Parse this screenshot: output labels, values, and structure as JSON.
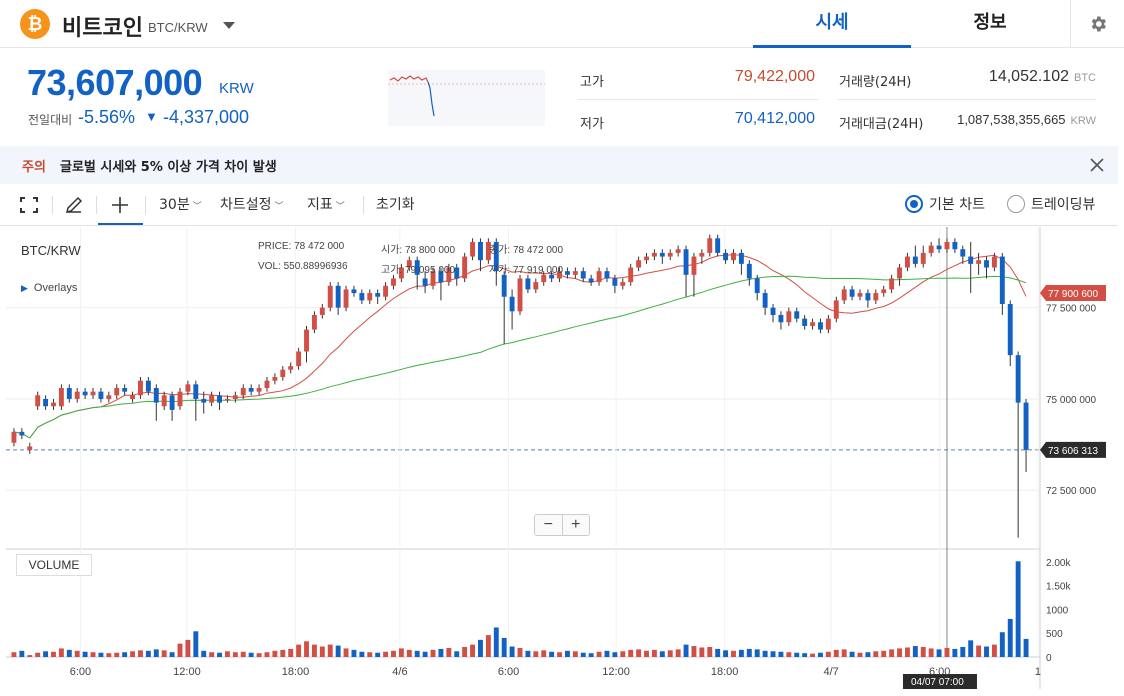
{
  "header": {
    "coin_logo": "₿",
    "coin_name": "비트코인",
    "pair": "BTC/KRW",
    "tabs": [
      {
        "label": "시세",
        "active": true
      },
      {
        "label": "정보",
        "active": false
      }
    ],
    "icons": {
      "logo": "bitcoin-icon",
      "dropdown": "caret-down-icon",
      "settings": "gear-icon"
    }
  },
  "price": {
    "current": "73,607,000",
    "unit": "KRW",
    "change_label": "전일대비",
    "change_rate": "-5.56%",
    "change_arrow": "▼",
    "change_amount": "-4,337,000"
  },
  "stats": {
    "high_label": "고가",
    "high_value": "79,422,000",
    "low_label": "저가",
    "low_value": "70,412,000",
    "volume_label": "거래량(24H)",
    "volume_value": "14,052.102",
    "volume_unit": "BTC",
    "amount_label": "거래대금(24H)",
    "amount_value": "1,087,538,355,665",
    "amount_unit": "KRW"
  },
  "notice": {
    "tag": "주의",
    "text": "글로벌 시세와 5% 이상 가격 차이 발생"
  },
  "toolbar": {
    "interval": "30분",
    "chart_settings": "차트설정",
    "indicators": "지표",
    "reset": "초기화",
    "chart_type_basic": "기본 차트",
    "chart_type_tradingview": "트레이딩뷰",
    "selected_chart_type": "기본 차트"
  },
  "chart_legend": {
    "pair": "BTC/KRW",
    "overlays": "Overlays",
    "price_label": "PRICE:",
    "price_value": "78 472 000",
    "vol_label": "VOL:",
    "vol_value": "550.88996936",
    "open_label": "시가:",
    "open_value": "78 800 000",
    "high_label": "고가:",
    "high_value": "79 095 000",
    "close_label": "종가:",
    "close_value": "78 472 000",
    "low_label": "저가:",
    "low_value": "77 919 000",
    "volume_panel": "VOLUME"
  },
  "colors": {
    "up": "#d24f45",
    "down": "#1261c4",
    "ma_short": "#d24f45",
    "ma_long": "#3cb043"
  },
  "chart_data": {
    "type": "candlestick",
    "price_axis_ticks": [
      "77 500 000",
      "75 000 000",
      "72 500 000"
    ],
    "price_tick_values": [
      77500000,
      75000000,
      72500000
    ],
    "price_badges": [
      {
        "label": "77 900 600",
        "value": 77900600,
        "kind": "ma"
      },
      {
        "label": "73 606 313",
        "value": 73606313,
        "kind": "last"
      }
    ],
    "volume_axis_ticks": [
      "2.00k",
      "1.50k",
      "1000",
      "500",
      "0"
    ],
    "time_labels": [
      "6:00",
      "12:00",
      "18:00",
      "4/6",
      "6:00",
      "12:00",
      "18:00",
      "4/7",
      "6:00",
      "1"
    ],
    "crosshair_label": "04/07 07:00",
    "candles": [
      {
        "o": 73800000,
        "c": 74100000,
        "h": 74200000,
        "l": 73700000,
        "v": 100
      },
      {
        "o": 74100000,
        "c": 74000000,
        "h": 74200000,
        "l": 73900000,
        "v": 130
      },
      {
        "o": 73600000,
        "c": 73700000,
        "h": 73800000,
        "l": 73500000,
        "v": 40
      },
      {
        "o": 74800000,
        "c": 75100000,
        "h": 75200000,
        "l": 74700000,
        "v": 90
      },
      {
        "o": 75000000,
        "c": 74800000,
        "h": 75100000,
        "l": 74700000,
        "v": 120
      },
      {
        "o": 74800000,
        "c": 74900000,
        "h": 75000000,
        "l": 74700000,
        "v": 110
      },
      {
        "o": 74800000,
        "c": 75300000,
        "h": 75400000,
        "l": 74700000,
        "v": 180
      },
      {
        "o": 75300000,
        "c": 75000000,
        "h": 75400000,
        "l": 74900000,
        "v": 150
      },
      {
        "o": 75000000,
        "c": 75200000,
        "h": 75300000,
        "l": 74900000,
        "v": 130
      },
      {
        "o": 75200000,
        "c": 75100000,
        "h": 75300000,
        "l": 75000000,
        "v": 110
      },
      {
        "o": 75100000,
        "c": 75200000,
        "h": 75300000,
        "l": 75000000,
        "v": 100
      },
      {
        "o": 75200000,
        "c": 75000000,
        "h": 75300000,
        "l": 74900000,
        "v": 90
      },
      {
        "o": 75000000,
        "c": 75100000,
        "h": 75200000,
        "l": 74900000,
        "v": 80
      },
      {
        "o": 75100000,
        "c": 75300000,
        "h": 75400000,
        "l": 75000000,
        "v": 90
      },
      {
        "o": 75300000,
        "c": 75200000,
        "h": 75400000,
        "l": 75100000,
        "v": 100
      },
      {
        "o": 75000000,
        "c": 75100000,
        "h": 75200000,
        "l": 74900000,
        "v": 120
      },
      {
        "o": 75100000,
        "c": 75500000,
        "h": 75600000,
        "l": 75000000,
        "v": 140
      },
      {
        "o": 75500000,
        "c": 75200000,
        "h": 75600000,
        "l": 75100000,
        "v": 130
      },
      {
        "o": 75300000,
        "c": 74900000,
        "h": 75400000,
        "l": 74400000,
        "v": 160
      },
      {
        "o": 74800000,
        "c": 75100000,
        "h": 75200000,
        "l": 74700000,
        "v": 140
      },
      {
        "o": 75100000,
        "c": 74700000,
        "h": 75200000,
        "l": 74400000,
        "v": 100
      },
      {
        "o": 74800000,
        "c": 75200000,
        "h": 75300000,
        "l": 74700000,
        "v": 280
      },
      {
        "o": 75200000,
        "c": 75400000,
        "h": 75500000,
        "l": 75100000,
        "v": 360
      },
      {
        "o": 75400000,
        "c": 75000000,
        "h": 75500000,
        "l": 74400000,
        "v": 540
      },
      {
        "o": 75000000,
        "c": 74900000,
        "h": 75200000,
        "l": 74600000,
        "v": 130
      },
      {
        "o": 74900000,
        "c": 75100000,
        "h": 75200000,
        "l": 74800000,
        "v": 100
      },
      {
        "o": 75100000,
        "c": 74900000,
        "h": 75200000,
        "l": 74700000,
        "v": 90
      },
      {
        "o": 75000000,
        "c": 75000000,
        "h": 75100000,
        "l": 74900000,
        "v": 120
      },
      {
        "o": 75000000,
        "c": 75100000,
        "h": 75200000,
        "l": 74900000,
        "v": 100
      },
      {
        "o": 75100000,
        "c": 75300000,
        "h": 75400000,
        "l": 75000000,
        "v": 110
      },
      {
        "o": 75300000,
        "c": 75200000,
        "h": 75400000,
        "l": 75100000,
        "v": 90
      },
      {
        "o": 75200000,
        "c": 75300000,
        "h": 75400000,
        "l": 75100000,
        "v": 80
      },
      {
        "o": 75300000,
        "c": 75500000,
        "h": 75600000,
        "l": 75200000,
        "v": 100
      },
      {
        "o": 75500000,
        "c": 75600000,
        "h": 75700000,
        "l": 75400000,
        "v": 130
      },
      {
        "o": 75600000,
        "c": 75800000,
        "h": 75900000,
        "l": 75500000,
        "v": 150
      },
      {
        "o": 75800000,
        "c": 75900000,
        "h": 76000000,
        "l": 75700000,
        "v": 170
      },
      {
        "o": 75900000,
        "c": 76300000,
        "h": 76400000,
        "l": 75800000,
        "v": 260
      },
      {
        "o": 76300000,
        "c": 76900000,
        "h": 77000000,
        "l": 76000000,
        "v": 330
      },
      {
        "o": 76900000,
        "c": 77300000,
        "h": 77400000,
        "l": 76800000,
        "v": 260
      },
      {
        "o": 77300000,
        "c": 77500000,
        "h": 77600000,
        "l": 77200000,
        "v": 220
      },
      {
        "o": 77500000,
        "c": 78100000,
        "h": 78200000,
        "l": 77400000,
        "v": 260
      },
      {
        "o": 78100000,
        "c": 77500000,
        "h": 78200000,
        "l": 77300000,
        "v": 240
      },
      {
        "o": 77500000,
        "c": 78000000,
        "h": 78100000,
        "l": 77400000,
        "v": 180
      },
      {
        "o": 78000000,
        "c": 77900000,
        "h": 78100000,
        "l": 77800000,
        "v": 150
      },
      {
        "o": 77900000,
        "c": 77700000,
        "h": 78000000,
        "l": 77600000,
        "v": 110
      },
      {
        "o": 77700000,
        "c": 77900000,
        "h": 78000000,
        "l": 77600000,
        "v": 100
      },
      {
        "o": 77900000,
        "c": 77800000,
        "h": 78000000,
        "l": 77600000,
        "v": 90
      },
      {
        "o": 77800000,
        "c": 78100000,
        "h": 78200000,
        "l": 77700000,
        "v": 110
      },
      {
        "o": 78100000,
        "c": 78300000,
        "h": 78400000,
        "l": 78000000,
        "v": 130
      },
      {
        "o": 78300000,
        "c": 78600000,
        "h": 78700000,
        "l": 78200000,
        "v": 180
      },
      {
        "o": 78600000,
        "c": 78800000,
        "h": 78900000,
        "l": 78500000,
        "v": 150
      },
      {
        "o": 78800000,
        "c": 78400000,
        "h": 78900000,
        "l": 78000000,
        "v": 130
      },
      {
        "o": 78300000,
        "c": 78100000,
        "h": 78500000,
        "l": 77900000,
        "v": 110
      },
      {
        "o": 78100000,
        "c": 78500000,
        "h": 78600000,
        "l": 78000000,
        "v": 150
      },
      {
        "o": 78500000,
        "c": 78200000,
        "h": 78600000,
        "l": 77700000,
        "v": 170
      },
      {
        "o": 78200000,
        "c": 78600000,
        "h": 78700000,
        "l": 78100000,
        "v": 190
      },
      {
        "o": 78600000,
        "c": 78300000,
        "h": 78700000,
        "l": 78100000,
        "v": 120
      },
      {
        "o": 78300000,
        "c": 78900000,
        "h": 79000000,
        "l": 78200000,
        "v": 210
      },
      {
        "o": 78900000,
        "c": 79300000,
        "h": 79400000,
        "l": 78800000,
        "v": 260
      },
      {
        "o": 79300000,
        "c": 78800000,
        "h": 79400000,
        "l": 78500000,
        "v": 360
      },
      {
        "o": 78800000,
        "c": 79300000,
        "h": 79400000,
        "l": 78700000,
        "v": 460
      },
      {
        "o": 79300000,
        "c": 78500000,
        "h": 79400000,
        "l": 78100000,
        "v": 620
      },
      {
        "o": 78400000,
        "c": 77800000,
        "h": 78500000,
        "l": 76500000,
        "v": 400
      },
      {
        "o": 77800000,
        "c": 77400000,
        "h": 78000000,
        "l": 76900000,
        "v": 220
      },
      {
        "o": 77400000,
        "c": 78300000,
        "h": 78400000,
        "l": 77300000,
        "v": 190
      },
      {
        "o": 78300000,
        "c": 78000000,
        "h": 78400000,
        "l": 77900000,
        "v": 130
      },
      {
        "o": 78000000,
        "c": 78200000,
        "h": 78300000,
        "l": 77900000,
        "v": 120
      },
      {
        "o": 78200000,
        "c": 78400000,
        "h": 78500000,
        "l": 78100000,
        "v": 140
      },
      {
        "o": 78400000,
        "c": 78300000,
        "h": 78500000,
        "l": 78200000,
        "v": 110
      },
      {
        "o": 78300000,
        "c": 78500000,
        "h": 78600000,
        "l": 78200000,
        "v": 100
      },
      {
        "o": 78500000,
        "c": 78400000,
        "h": 78600000,
        "l": 78300000,
        "v": 130
      },
      {
        "o": 78400000,
        "c": 78500000,
        "h": 78600000,
        "l": 78300000,
        "v": 120
      },
      {
        "o": 78500000,
        "c": 78300000,
        "h": 78600000,
        "l": 78200000,
        "v": 90
      },
      {
        "o": 78300000,
        "c": 78200000,
        "h": 78400000,
        "l": 78100000,
        "v": 80
      },
      {
        "o": 78200000,
        "c": 78500000,
        "h": 78600000,
        "l": 78100000,
        "v": 110
      },
      {
        "o": 78500000,
        "c": 78300000,
        "h": 78600000,
        "l": 78200000,
        "v": 130
      },
      {
        "o": 78300000,
        "c": 78100000,
        "h": 78400000,
        "l": 77900000,
        "v": 100
      },
      {
        "o": 78100000,
        "c": 78200000,
        "h": 78300000,
        "l": 78000000,
        "v": 120
      },
      {
        "o": 78200000,
        "c": 78600000,
        "h": 78700000,
        "l": 78100000,
        "v": 150
      },
      {
        "o": 78600000,
        "c": 78800000,
        "h": 78900000,
        "l": 78500000,
        "v": 160
      },
      {
        "o": 78800000,
        "c": 78900000,
        "h": 79000000,
        "l": 78700000,
        "v": 130
      },
      {
        "o": 78900000,
        "c": 79000000,
        "h": 79100000,
        "l": 78800000,
        "v": 150
      },
      {
        "o": 79000000,
        "c": 78900000,
        "h": 79100000,
        "l": 78700000,
        "v": 120
      },
      {
        "o": 78900000,
        "c": 79000000,
        "h": 79100000,
        "l": 78800000,
        "v": 140
      },
      {
        "o": 79000000,
        "c": 79100000,
        "h": 79200000,
        "l": 78900000,
        "v": 160
      },
      {
        "o": 79100000,
        "c": 78400000,
        "h": 79200000,
        "l": 77800000,
        "v": 260
      },
      {
        "o": 78400000,
        "c": 78900000,
        "h": 79000000,
        "l": 77800000,
        "v": 230
      },
      {
        "o": 78900000,
        "c": 79000000,
        "h": 79100000,
        "l": 78700000,
        "v": 200
      },
      {
        "o": 79000000,
        "c": 79400000,
        "h": 79500000,
        "l": 78900000,
        "v": 210
      },
      {
        "o": 79400000,
        "c": 79000000,
        "h": 79500000,
        "l": 78900000,
        "v": 170
      },
      {
        "o": 79000000,
        "c": 78800000,
        "h": 79100000,
        "l": 78700000,
        "v": 140
      },
      {
        "o": 78800000,
        "c": 79000000,
        "h": 79100000,
        "l": 78700000,
        "v": 130
      },
      {
        "o": 79000000,
        "c": 78700000,
        "h": 79100000,
        "l": 78400000,
        "v": 150
      },
      {
        "o": 78700000,
        "c": 78300000,
        "h": 78800000,
        "l": 78100000,
        "v": 170
      },
      {
        "o": 78300000,
        "c": 77900000,
        "h": 78400000,
        "l": 77700000,
        "v": 160
      },
      {
        "o": 77900000,
        "c": 77500000,
        "h": 78000000,
        "l": 77300000,
        "v": 130
      },
      {
        "o": 77500000,
        "c": 77300000,
        "h": 77600000,
        "l": 77100000,
        "v": 120
      },
      {
        "o": 77300000,
        "c": 77100000,
        "h": 77400000,
        "l": 76900000,
        "v": 110
      },
      {
        "o": 77100000,
        "c": 77400000,
        "h": 77500000,
        "l": 77000000,
        "v": 100
      },
      {
        "o": 77400000,
        "c": 77200000,
        "h": 77500000,
        "l": 77100000,
        "v": 90
      },
      {
        "o": 77200000,
        "c": 77000000,
        "h": 77300000,
        "l": 76900000,
        "v": 80
      },
      {
        "o": 77000000,
        "c": 77100000,
        "h": 77200000,
        "l": 76900000,
        "v": 70
      },
      {
        "o": 77100000,
        "c": 76900000,
        "h": 77200000,
        "l": 76800000,
        "v": 90
      },
      {
        "o": 76900000,
        "c": 77200000,
        "h": 77300000,
        "l": 76800000,
        "v": 110
      },
      {
        "o": 77200000,
        "c": 77700000,
        "h": 77800000,
        "l": 77100000,
        "v": 150
      },
      {
        "o": 77700000,
        "c": 78000000,
        "h": 78100000,
        "l": 77600000,
        "v": 160
      },
      {
        "o": 78000000,
        "c": 77800000,
        "h": 78100000,
        "l": 77700000,
        "v": 110
      },
      {
        "o": 77800000,
        "c": 77900000,
        "h": 78000000,
        "l": 77700000,
        "v": 90
      },
      {
        "o": 77900000,
        "c": 77700000,
        "h": 78000000,
        "l": 77500000,
        "v": 100
      },
      {
        "o": 77700000,
        "c": 77900000,
        "h": 78000000,
        "l": 77600000,
        "v": 120
      },
      {
        "o": 77900000,
        "c": 78000000,
        "h": 78100000,
        "l": 77800000,
        "v": 130
      },
      {
        "o": 78000000,
        "c": 78300000,
        "h": 78400000,
        "l": 77900000,
        "v": 160
      },
      {
        "o": 78300000,
        "c": 78600000,
        "h": 78700000,
        "l": 78100000,
        "v": 180
      },
      {
        "o": 78600000,
        "c": 78900000,
        "h": 79000000,
        "l": 78500000,
        "v": 200
      },
      {
        "o": 78900000,
        "c": 78700000,
        "h": 79200000,
        "l": 78600000,
        "v": 230
      },
      {
        "o": 78700000,
        "c": 79000000,
        "h": 79200000,
        "l": 78600000,
        "v": 210
      },
      {
        "o": 79000000,
        "c": 79200000,
        "h": 79300000,
        "l": 78900000,
        "v": 180
      },
      {
        "o": 79200000,
        "c": 79100000,
        "h": 79400000,
        "l": 79000000,
        "v": 160
      },
      {
        "o": 79100000,
        "c": 79300000,
        "h": 79400000,
        "l": 79000000,
        "v": 190
      },
      {
        "o": 79300000,
        "c": 79100000,
        "h": 79400000,
        "l": 79000000,
        "v": 170
      },
      {
        "o": 79100000,
        "c": 78900000,
        "h": 79200000,
        "l": 78700000,
        "v": 210
      },
      {
        "o": 78900000,
        "c": 78700000,
        "h": 79300000,
        "l": 77900000,
        "v": 350
      },
      {
        "o": 78700000,
        "c": 78800000,
        "h": 79000000,
        "l": 78400000,
        "v": 240
      },
      {
        "o": 78800000,
        "c": 78600000,
        "h": 78900000,
        "l": 78300000,
        "v": 220
      },
      {
        "o": 78600000,
        "c": 78900000,
        "h": 79000000,
        "l": 78500000,
        "v": 260
      },
      {
        "o": 78900000,
        "c": 77600000,
        "h": 79000000,
        "l": 77300000,
        "v": 520
      },
      {
        "o": 77600000,
        "c": 76200000,
        "h": 77700000,
        "l": 75900000,
        "v": 800
      },
      {
        "o": 76200000,
        "c": 74900000,
        "h": 76300000,
        "l": 71200000,
        "v": 2010
      },
      {
        "o": 74900000,
        "c": 73606313,
        "h": 75000000,
        "l": 73000000,
        "v": 380
      }
    ]
  }
}
